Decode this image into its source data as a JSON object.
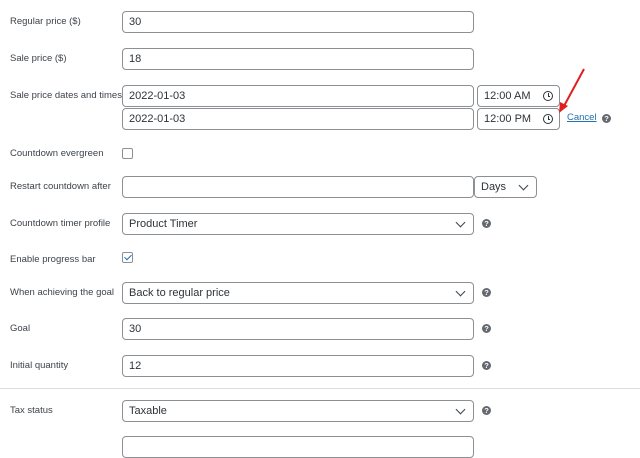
{
  "form": {
    "regular_price": {
      "label": "Regular price ($)",
      "value": "30"
    },
    "sale_price": {
      "label": "Sale price ($)",
      "value": "18"
    },
    "sale_dates": {
      "label": "Sale price dates and times",
      "from_date": "2022-01-03",
      "from_time": "12:00 AM",
      "to_date": "2022-01-03",
      "to_time": "12:00 PM",
      "cancel_label": "Cancel"
    },
    "countdown_evergreen": {
      "label": "Countdown evergreen",
      "checked": false
    },
    "restart_countdown": {
      "label": "Restart countdown after",
      "value": "",
      "unit": "Days"
    },
    "timer_profile": {
      "label": "Countdown timer profile",
      "value": "Product Timer"
    },
    "enable_progress_bar": {
      "label": "Enable progress bar",
      "checked": true
    },
    "achieving_goal": {
      "label": "When achieving the goal",
      "value": "Back to regular price"
    },
    "goal": {
      "label": "Goal",
      "value": "30"
    },
    "initial_quantity": {
      "label": "Initial quantity",
      "value": "12"
    },
    "tax_status": {
      "label": "Tax status",
      "value": "Taxable"
    }
  },
  "help_icon_glyph": "?",
  "colors": {
    "accent": "#2271b1",
    "arrow": "#e02020",
    "border": "#8c8f94"
  }
}
